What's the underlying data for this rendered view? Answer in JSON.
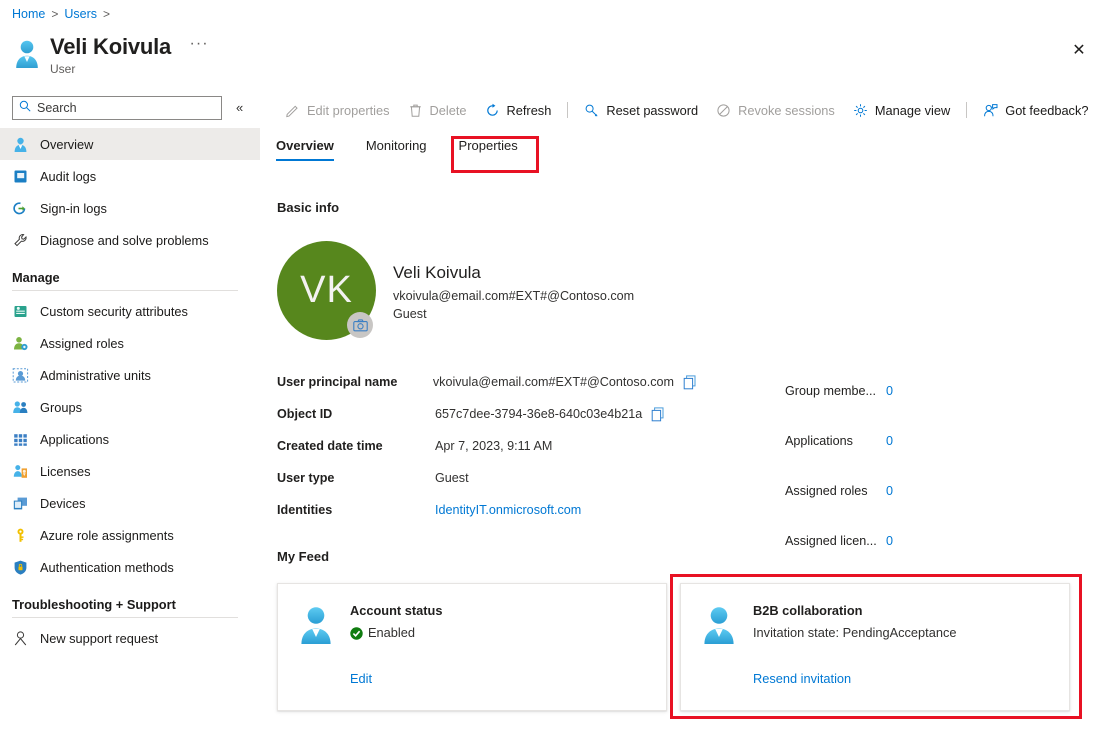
{
  "breadcrumb": {
    "items": [
      "Home",
      "Users"
    ]
  },
  "header": {
    "title": "Veli Koivula",
    "subtitle": "User",
    "more_label": "···",
    "close_label": "✕",
    "avatar_icon": "user-icon"
  },
  "search": {
    "placeholder": "Search",
    "value": "",
    "icon": "search-icon"
  },
  "collapse": {
    "label": "«"
  },
  "sidebar": {
    "items": [
      {
        "label": "Overview",
        "icon": "user-icon",
        "selected": true
      },
      {
        "label": "Audit logs",
        "icon": "audit-log-icon",
        "selected": false
      },
      {
        "label": "Sign-in logs",
        "icon": "sign-in-icon",
        "selected": false
      },
      {
        "label": "Diagnose and solve problems",
        "icon": "wrench-icon",
        "selected": false
      }
    ],
    "groups": [
      {
        "title": "Manage",
        "items": [
          {
            "label": "Custom security attributes",
            "icon": "custom-attributes-icon"
          },
          {
            "label": "Assigned roles",
            "icon": "assigned-roles-icon"
          },
          {
            "label": "Administrative units",
            "icon": "administrative-units-icon"
          },
          {
            "label": "Groups",
            "icon": "groups-icon"
          },
          {
            "label": "Applications",
            "icon": "applications-icon"
          },
          {
            "label": "Licenses",
            "icon": "licenses-icon"
          },
          {
            "label": "Devices",
            "icon": "devices-icon"
          },
          {
            "label": "Azure role assignments",
            "icon": "key-icon"
          },
          {
            "label": "Authentication methods",
            "icon": "shield-lock-icon"
          }
        ]
      },
      {
        "title": "Troubleshooting + Support",
        "items": [
          {
            "label": "New support request",
            "icon": "support-person-icon"
          }
        ]
      }
    ]
  },
  "commandbar": {
    "items": [
      {
        "label": "Edit properties",
        "icon": "pencil-icon",
        "disabled": true
      },
      {
        "label": "Delete",
        "icon": "trash-icon",
        "disabled": true
      },
      {
        "label": "Refresh",
        "icon": "refresh-icon",
        "disabled": false
      },
      {
        "label": "Reset password",
        "icon": "key-icon",
        "disabled": false
      },
      {
        "label": "Revoke sessions",
        "icon": "block-icon",
        "disabled": true
      },
      {
        "label": "Manage view",
        "icon": "gear-icon",
        "disabled": false
      },
      {
        "label": "Got feedback?",
        "icon": "feedback-person-icon",
        "disabled": false
      }
    ]
  },
  "tabs": [
    {
      "label": "Overview",
      "active": true
    },
    {
      "label": "Monitoring",
      "active": false
    },
    {
      "label": "Properties",
      "active": false,
      "highlighted": true
    }
  ],
  "basic_info": {
    "section_title": "Basic info",
    "avatar_initials": "VK",
    "avatar_color": "#57871d",
    "camera_icon": "camera-icon",
    "name": "Veli Koivula",
    "email": "vkoivula@email.com#EXT#@Contoso.com",
    "user_type": "Guest",
    "properties": [
      {
        "label": "User principal name",
        "value": "vkoivula@email.com#EXT#@Contoso.com",
        "copy": true,
        "link": false
      },
      {
        "label": "Object ID",
        "value": "657c7dee-3794-36e8-640c03e4b21a",
        "copy": true,
        "link": false
      },
      {
        "label": "Created date time",
        "value": "Apr 7, 2023, 9:11 AM",
        "copy": false,
        "link": false
      },
      {
        "label": "User type",
        "value": "Guest",
        "copy": false,
        "link": false
      },
      {
        "label": "Identities",
        "value": "IdentityIT.onmicrosoft.com",
        "copy": false,
        "link": true
      }
    ],
    "stats": [
      {
        "label": "Group membe...",
        "value": "0"
      },
      {
        "label": "Applications",
        "value": "0"
      },
      {
        "label": "Assigned roles",
        "value": "0"
      },
      {
        "label": "Assigned licen...",
        "value": "0"
      }
    ]
  },
  "my_feed": {
    "section_title": "My Feed",
    "cards": [
      {
        "title": "Account status",
        "status_text": "Enabled",
        "status_color": "#107c10",
        "has_status_icon": true,
        "link": "Edit",
        "icon": "user-icon",
        "highlighted": false
      },
      {
        "title": "B2B collaboration",
        "status_text": "Invitation state: PendingAcceptance",
        "status_color": "#323130",
        "has_status_icon": false,
        "link": "Resend invitation",
        "icon": "user-icon",
        "highlighted": true
      }
    ]
  },
  "colors": {
    "accent": "#0078d4",
    "highlight_box": "#e81123",
    "selected_nav": "#edebe9",
    "avatar_green": "#57871d",
    "status_green": "#107c10"
  }
}
